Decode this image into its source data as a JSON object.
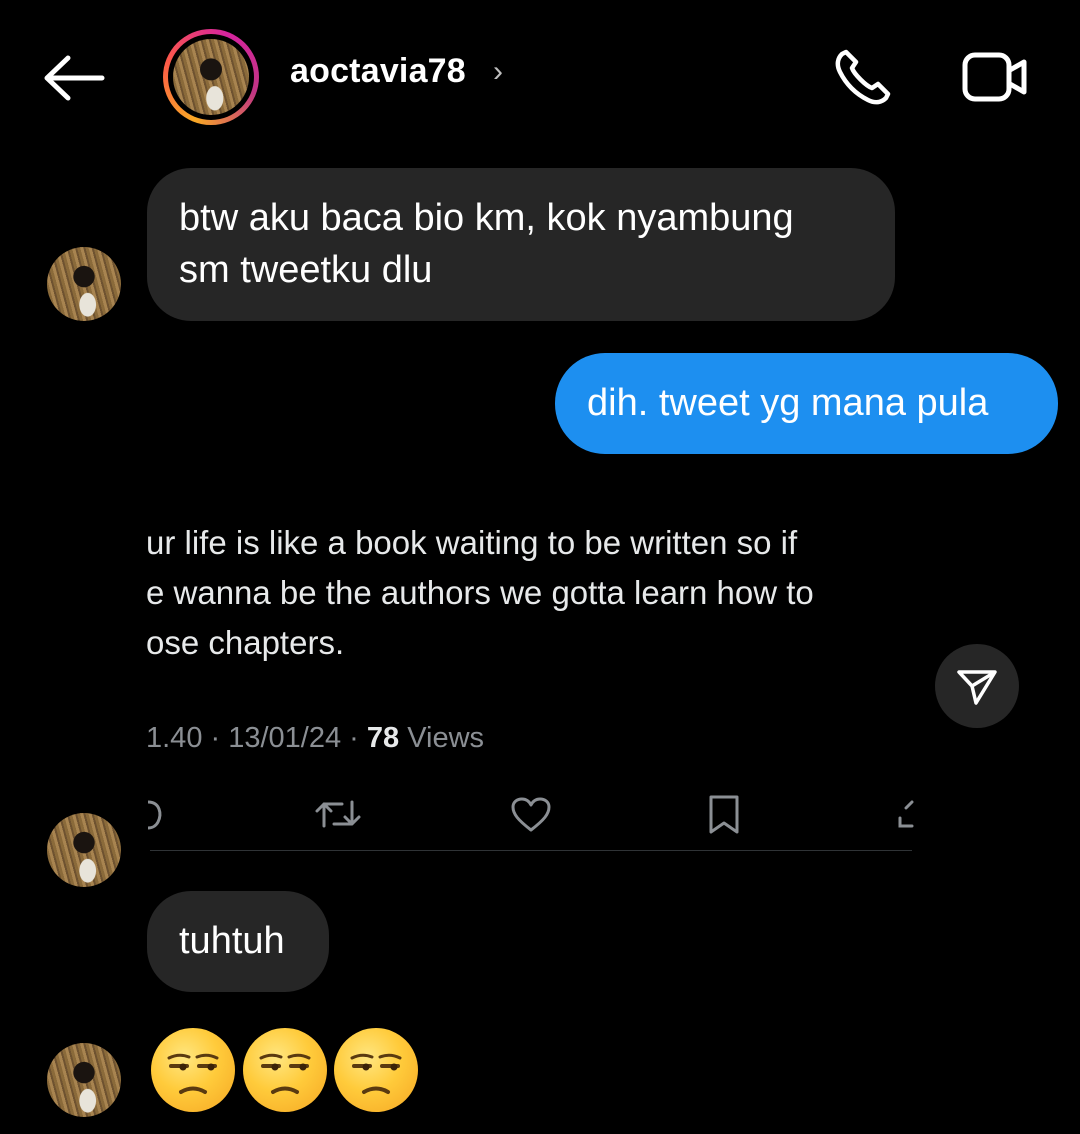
{
  "header": {
    "username": "aoctavia78",
    "chevron": "›",
    "back_icon": "arrow-left-icon",
    "call_icon": "phone-icon",
    "video_icon": "video-camera-icon"
  },
  "messages": [
    {
      "from": "them",
      "text": "btw aku baca bio km, kok nyambung\nsm tweetku dlu"
    },
    {
      "from": "me",
      "text": "dih. tweet yg mana pula"
    },
    {
      "from": "them",
      "text": "tuhtuh"
    }
  ],
  "tweet": {
    "text": "ur life is like a book waiting to be written so if\ne wanna be the authors we gotta learn how to\nose chapters.",
    "time": "1.40 · 13/01/24 · ",
    "views_count": "78",
    "views_label": " Views"
  },
  "emoji_reaction": [
    "unamused-face",
    "unamused-face",
    "unamused-face"
  ],
  "colors": {
    "accent": "#1d8ff0",
    "bubble_in": "#262626",
    "background": "#000000"
  }
}
